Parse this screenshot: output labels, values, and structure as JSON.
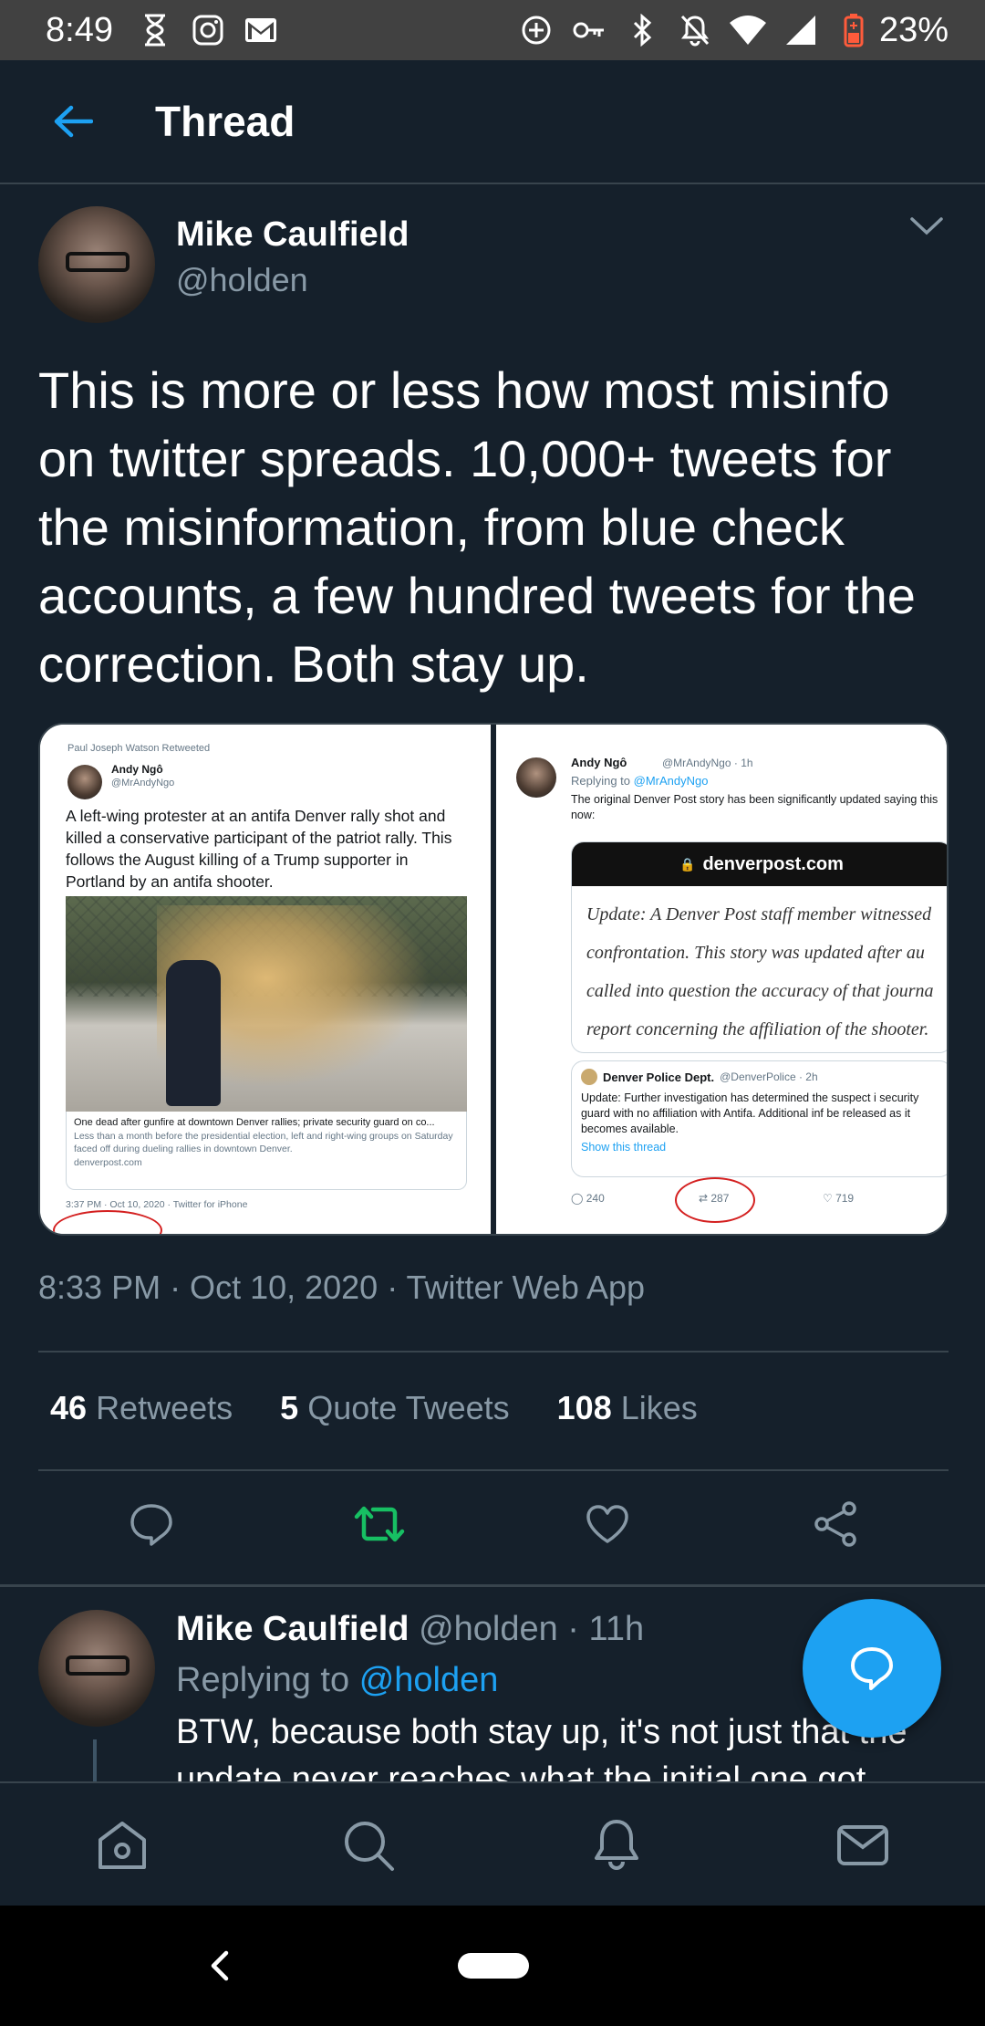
{
  "status_bar": {
    "time": "8:49",
    "battery": "23%"
  },
  "header": {
    "title": "Thread"
  },
  "tweet": {
    "author_name": "Mike Caulfield",
    "author_handle": "@holden",
    "text": "This is more or less how most misinfo on twitter spreads. 10,000+ tweets for the misinformation, from blue check accounts, a few hundred tweets for the correction. Both stay up.",
    "meta": "8:33 PM · Oct 10, 2020 · Twitter Web App",
    "stats": [
      {
        "num": "46",
        "label": "Retweets"
      },
      {
        "num": "5",
        "label": "Quote Tweets"
      },
      {
        "num": "108",
        "label": "Likes"
      }
    ]
  },
  "media": {
    "left": {
      "retweeted_by": "Paul Joseph Watson Retweeted",
      "name": "Andy Ngô",
      "handle": "@MrAndyNgo",
      "text": "A left-wing protester at an antifa Denver rally shot and killed a conservative participant of the patriot rally. This follows the August killing of a Trump supporter in Portland by an antifa shooter.",
      "card_title": "One dead after gunfire at downtown Denver rallies; private security guard on co...",
      "card_desc": "Less than a month before the presidential election, left and right-wing groups on Saturday faced off during dueling rallies in downtown Denver.",
      "card_domain": "denverpost.com",
      "footer": "3:37 PM · Oct 10, 2020 · Twitter for iPhone"
    },
    "right": {
      "name": "Andy Ngô",
      "handle_time": "@MrAndyNgo · 1h",
      "replying": "Replying to",
      "replying_handle": "@MrAndyNgo",
      "text": "The original Denver Post story has been significantly updated saying this now:",
      "post_domain": "denverpost.com",
      "post_lines": [
        "Update: A Denver Post staff member witnessed",
        "confrontation. This story was updated after au",
        "called into question the accuracy of that journa",
        "report concerning the affiliation of the shooter."
      ],
      "dpd_name": "Denver Police Dept.",
      "dpd_handle_time": "@DenverPolice · 2h",
      "dpd_text": "Update: Further investigation has determined the suspect i security guard with no affiliation with Antifa. Additional inf be released as it becomes available.",
      "show_thread": "Show this thread",
      "replies": "240",
      "retweets": "287",
      "likes": "719"
    }
  },
  "reply": {
    "author_name": "Mike Caulfield",
    "handle_time": "@holden · 11h",
    "replying": "Replying to",
    "replying_handle": "@holden",
    "text": "BTW, because both stay up, it's not just that the update never reaches what the initial one got"
  },
  "colors": {
    "background": "#15202b",
    "accent": "#1da1f2",
    "retweet_active": "#17bf63",
    "muted": "#8899a6"
  },
  "icons": [
    "back-arrow-icon",
    "chevron-down-icon",
    "reply-icon",
    "retweet-icon",
    "like-icon",
    "share-icon",
    "compose-icon",
    "home-icon",
    "search-icon",
    "notifications-icon",
    "messages-icon"
  ]
}
